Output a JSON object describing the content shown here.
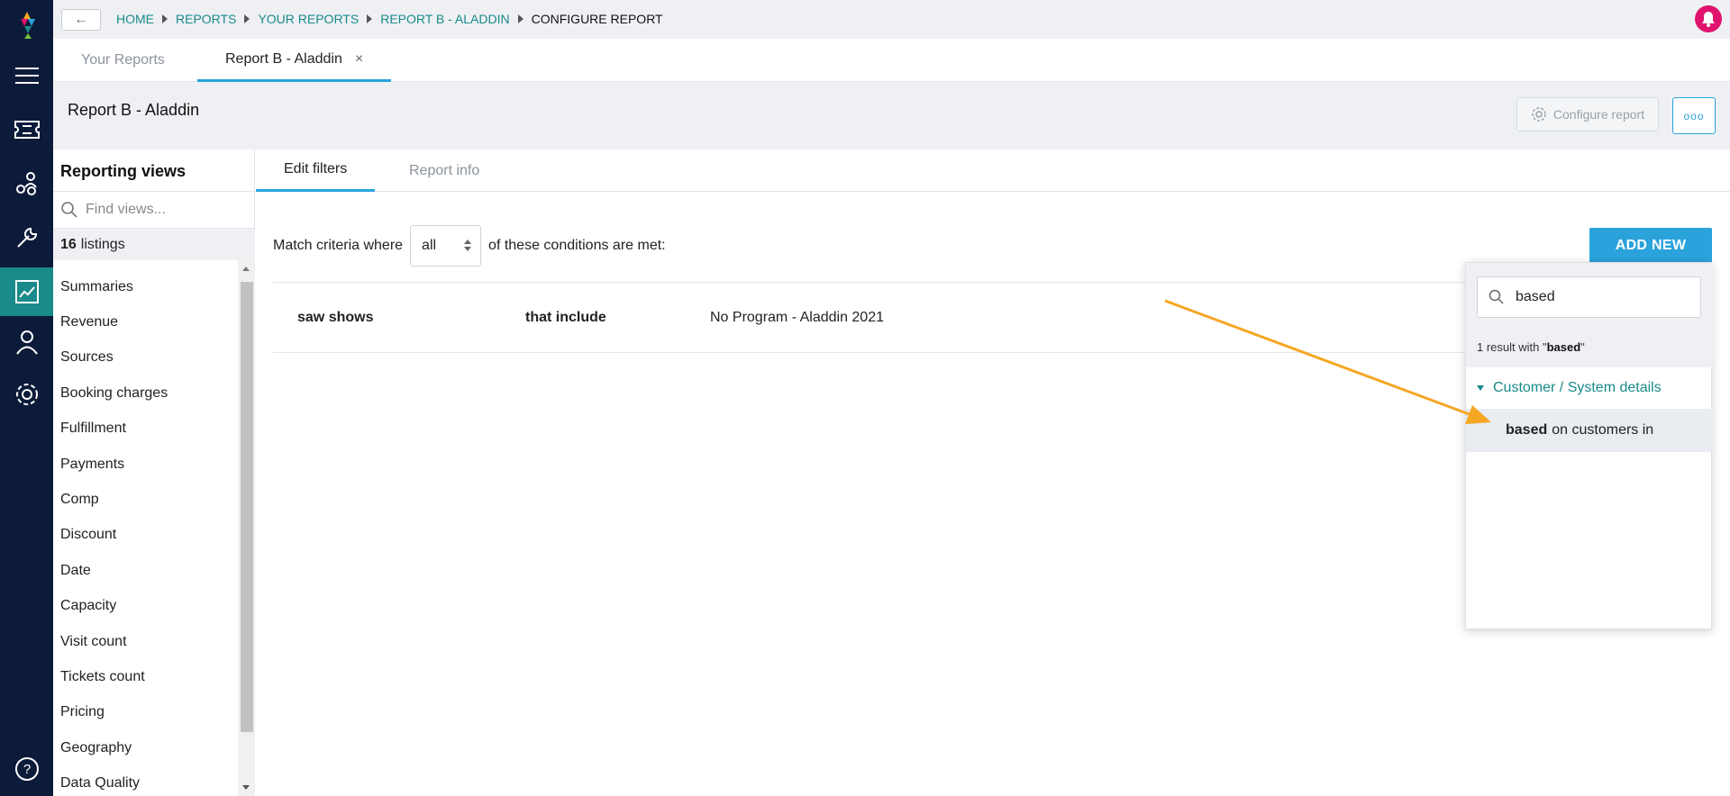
{
  "topbar": {
    "back_label": "←",
    "breadcrumbs": [
      "HOME",
      "REPORTS",
      "YOUR REPORTS",
      "REPORT B - ALADDIN",
      "CONFIGURE REPORT"
    ]
  },
  "tabs": [
    {
      "label": "Your Reports"
    },
    {
      "label": "Report B - Aladdin",
      "close": "×"
    }
  ],
  "page": {
    "title": "Report B - Aladdin",
    "configure_label": "Configure report",
    "more_label": "ooo"
  },
  "reporting_views": {
    "title": "Reporting views",
    "search_placeholder": "Find views...",
    "count": "16",
    "count_label": "listings",
    "items": [
      "Summaries",
      "Revenue",
      "Sources",
      "Booking charges",
      "Fulfillment",
      "Payments",
      "Comp",
      "Discount",
      "Date",
      "Capacity",
      "Visit count",
      "Tickets count",
      "Pricing",
      "Geography",
      "Data Quality"
    ]
  },
  "content_tabs": [
    {
      "label": "Edit filters"
    },
    {
      "label": "Report info"
    }
  ],
  "filters": {
    "match_prefix": "Match criteria where",
    "match_value": "all",
    "match_suffix": "of these conditions are met:",
    "add_new_label": "ADD NEW",
    "conditions": [
      {
        "field": "saw shows",
        "operator": "that include",
        "value": "No Program - Aladdin 2021"
      }
    ]
  },
  "dropdown": {
    "search_value": "based",
    "result_prefix": "1 result with \"",
    "result_term": "based",
    "result_suffix": "\"",
    "group": "Customer / System details",
    "item_bold": "based",
    "item_rest": "on customers in"
  },
  "colors": {
    "rail": "#0d1b3a",
    "accent_teal": "#1a8a8a",
    "accent_blue": "#2aa3dc",
    "bell": "#e0146e",
    "annotation_arrow": "#f5a623"
  }
}
